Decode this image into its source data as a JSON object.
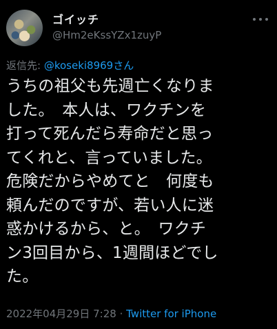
{
  "author": {
    "display_name": "ゴイッチ",
    "handle": "@Hm2eKssYZx1zuyP"
  },
  "reply": {
    "prefix": "返信先: ",
    "mention": "@koseki8969さん"
  },
  "tweet": {
    "lines": [
      "うちの祖父も先週亡くなりま",
      "した。　本人は、ワクチンを",
      "打って死んだら寿命だと思っ",
      "てくれと、言っていました。",
      "危険だからやめてと　何度も",
      "頼んだのですが、若い人に迷",
      "惑かけるから、と。　ワクチ",
      "ン3回目から、1週間ほどでし",
      "た。"
    ]
  },
  "meta": {
    "timestamp": "2022年04月29日 7:28",
    "separator": " · ",
    "source": "Twitter for iPhone"
  },
  "icons": {
    "more": "more-horizontal-icon"
  },
  "colors": {
    "background": "#000000",
    "text": "#e7e9ea",
    "secondary": "#71767b",
    "link": "#1d9bf0"
  }
}
